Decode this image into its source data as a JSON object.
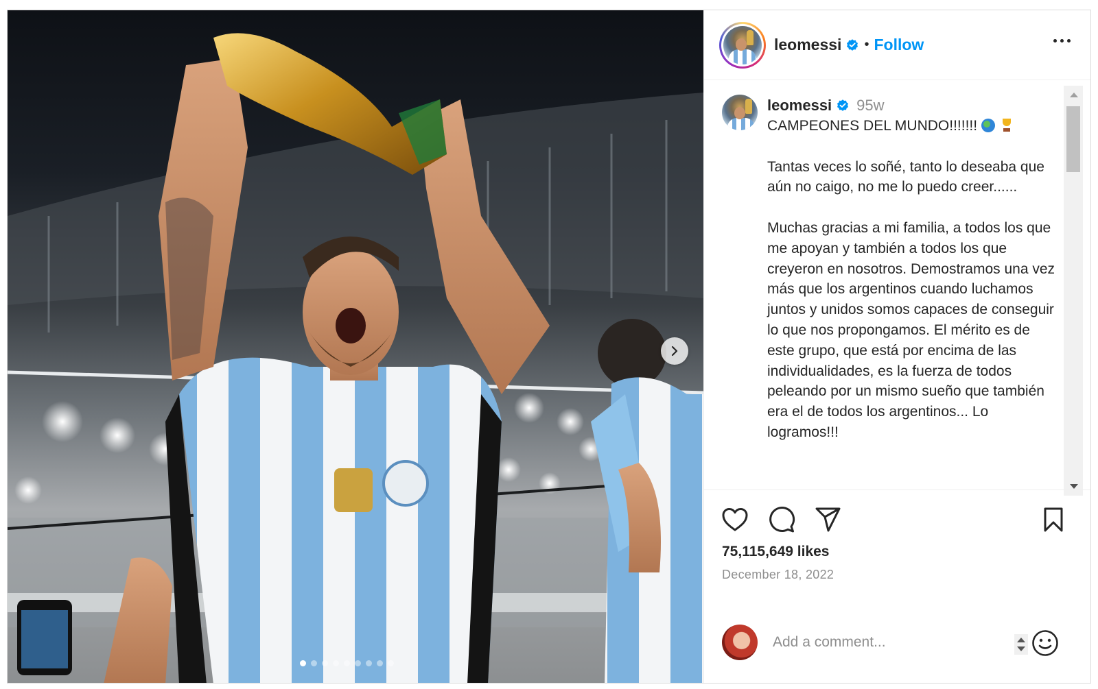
{
  "post": {
    "media": {
      "image_alt": "Player lifting the World Cup trophy in a stadium",
      "carousel_dots": 9,
      "active_dot": 0,
      "next_icon": "chevron-right-icon"
    },
    "header": {
      "username": "leomessi",
      "verified_icon": "verified-badge-icon",
      "separator": "•",
      "follow_label": "Follow",
      "more_icon": "more-options-icon"
    },
    "caption": {
      "username": "leomessi",
      "time_ago": "95w",
      "first_line": "CAMPEONES DEL MUNDO!!!!!!!",
      "paragraph_1": "Tantas veces lo soñé, tanto lo deseaba que aún no caigo, no me lo puedo creer......",
      "paragraph_2": "Muchas gracias a mi familia, a todos los que me apoyan y también a todos los que creyeron en nosotros. Demostramos una vez más que los argentinos cuando luchamos juntos y unidos somos capaces de conseguir lo que nos propongamos. El mérito es de este grupo, que está por encima de las individualidades, es la fuerza de todos peleando por un mismo sueño que también era el de todos los argentinos... Lo logramos!!!"
    },
    "actions": {
      "like_icon": "heart-icon",
      "comment_icon": "comment-icon",
      "share_icon": "share-icon",
      "save_icon": "bookmark-icon"
    },
    "likes_text": "75,115,649 likes",
    "date_text": "December 18, 2022",
    "comment_box": {
      "placeholder": "Add a comment...",
      "emoji_icon": "emoji-icon"
    },
    "colors": {
      "link_blue": "#0095f6",
      "text": "#262626",
      "muted": "#8e8e8e",
      "verified_blue": "#0095f6"
    }
  }
}
